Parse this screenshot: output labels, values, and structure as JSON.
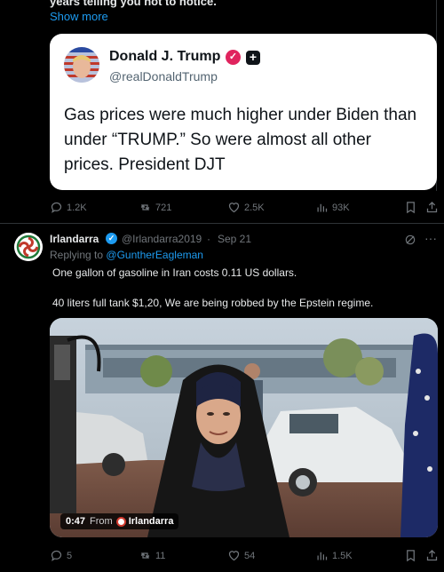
{
  "top_tweet": {
    "cut_text": "years telling you not to notice.",
    "show_more": "Show more",
    "quote": {
      "name": "Donald J. Trump",
      "handle": "@realDonaldTrump",
      "body": "Gas prices were much higher under Biden than under “TRUMP.” So were almost all other prices. President DJT",
      "verified_color": "#e0245e"
    },
    "actions": {
      "replies": "1.2K",
      "reposts": "721",
      "likes": "2.5K",
      "views": "93K"
    }
  },
  "tweet2": {
    "name": "Irlandarra",
    "handle": "@Irlandarra2019",
    "dot": "·",
    "date": "Sep 21",
    "reply_prefix": "Replying to",
    "reply_to": "@GuntherEagleman",
    "body_line1": "One gallon of gasoline in Iran costs 0.11 US dollars.",
    "body_line2": "40 liters full tank $1,20,  We are being robbed by the Epstein regime.",
    "video": {
      "time": "0:47",
      "from": "From",
      "user": "Irlandarra"
    },
    "actions": {
      "replies": "5",
      "reposts": "11",
      "likes": "54",
      "views": "1.5K"
    }
  },
  "icons": {
    "reply": "reply-icon",
    "repost": "repost-icon",
    "like": "heart-icon",
    "views": "views-icon",
    "bookmark": "bookmark-icon",
    "share": "share-icon",
    "grok": "grok-icon",
    "more": "more-icon"
  },
  "colors": {
    "background": "#000000",
    "link": "#1d9bf0",
    "muted": "#71767b",
    "card": "#ffffff"
  }
}
